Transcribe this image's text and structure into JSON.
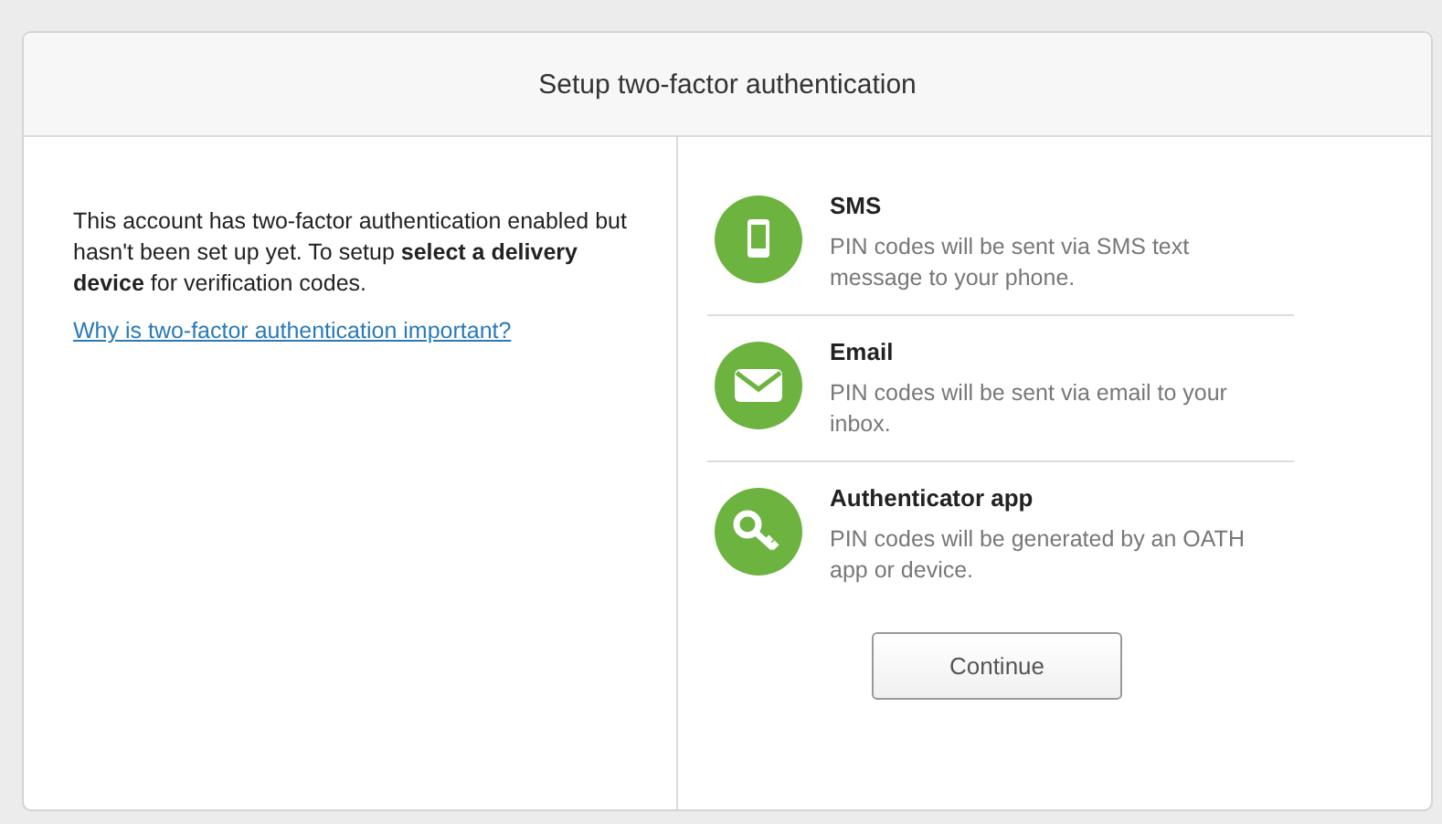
{
  "dialog": {
    "title": "Setup two-factor authentication"
  },
  "intro": {
    "text": "This account has two-factor authentication enabled but hasn't been set up yet. To setup **select a delivery device** for verification codes.",
    "link": "Why is two-factor authentication important?"
  },
  "methods": [
    {
      "kind": "phone",
      "title": "SMS",
      "description": "PIN codes will be sent via SMS text message to your phone."
    },
    {
      "kind": "email",
      "title": "Email",
      "description": "PIN codes will be sent via email to your inbox."
    },
    {
      "kind": "key",
      "title": "Authenticator app",
      "description": "PIN codes will be generated by an OATH app or device."
    }
  ],
  "button": "Continue"
}
